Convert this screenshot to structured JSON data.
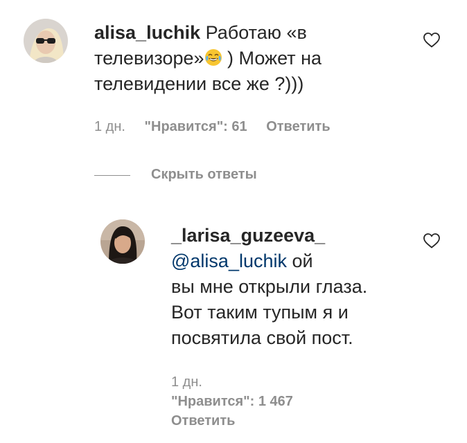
{
  "comment": {
    "username": "alisa_luchik",
    "text_line1": "Работаю «в",
    "text_line2_a": "телевизоре»",
    "emoji": "joy-emoji",
    "text_line2_b": " ) Может на",
    "text_line3": "телевидении все же ?)))",
    "time": "1 дн.",
    "likes": "\"Нравится\": 61",
    "reply_label": "Ответить"
  },
  "replies_toggle": {
    "label": "Скрыть ответы"
  },
  "reply": {
    "username": "_larisa_guzeeva_",
    "mention": "@alisa_luchik",
    "text_line1_b": " ой",
    "text_line2": "вы мне открыли глаза.",
    "text_line3": "Вот таким тупым я и",
    "text_line4": "посвятила свой пост.",
    "time": "1 дн.",
    "likes": "\"Нравится\": 1 467",
    "reply_label": "Ответить"
  },
  "colors": {
    "text": "#262626",
    "secondary": "#8e8e8e",
    "mention": "#00376b"
  }
}
